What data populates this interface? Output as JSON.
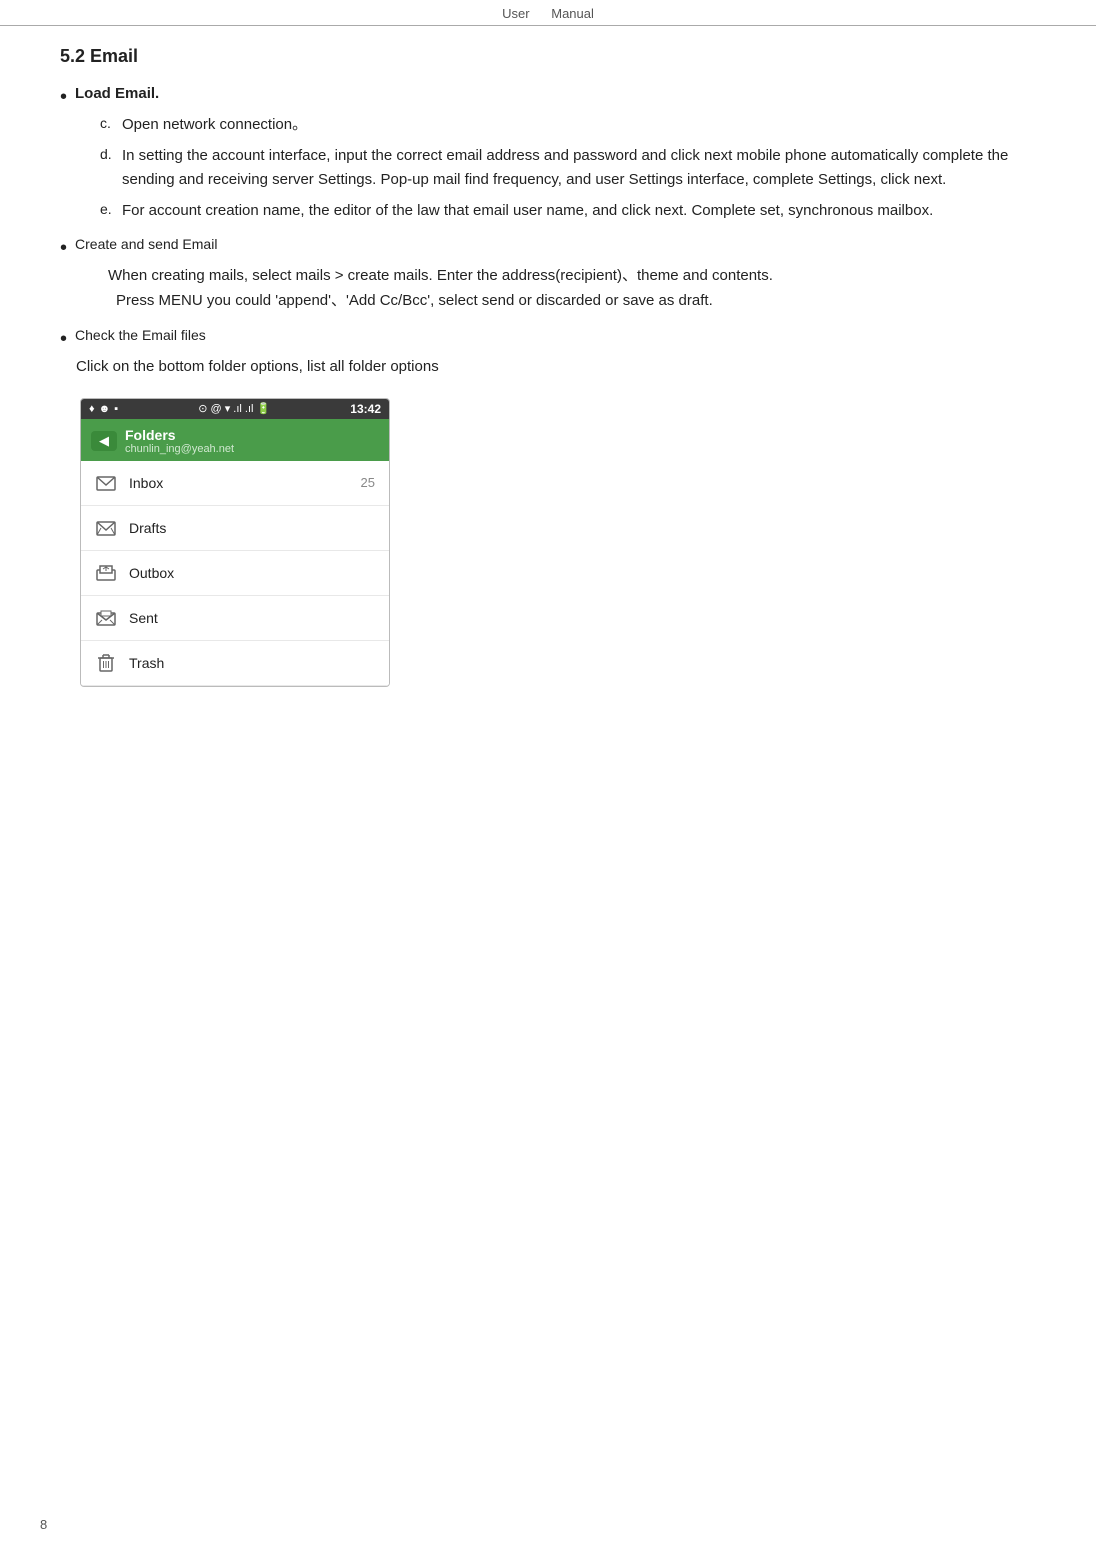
{
  "header": {
    "left": "User",
    "right": "Manual"
  },
  "section": {
    "title": "5.2 Email"
  },
  "bullets": [
    {
      "label": "Load Email.",
      "bold": true,
      "sub_items": [
        {
          "letter": "c.",
          "text": "Open network connection。"
        },
        {
          "letter": "d.",
          "text": "In setting the account interface, input the correct email address and password and click next mobile phone automatically complete the sending and receiving server Settings. Pop-up mail find frequency, and user Settings interface, complete Settings, click next."
        },
        {
          "letter": "e.",
          "text": "For account creation name, the editor of the law that email user name, and click next. Complete set, synchronous mailbox."
        }
      ]
    },
    {
      "label": "Create and send Email",
      "bold": false,
      "body_lines": [
        "When creating mails, select mails > create mails. Enter the address(recipient)、theme and contents.",
        "Press MENU you could 'append'、'Add Cc/Bcc',   select send or discarded or save as draft."
      ]
    },
    {
      "label": "Check the Email files",
      "bold": false,
      "body_lines": [
        "Click on the bottom folder options, list all folder options"
      ]
    }
  ],
  "phone": {
    "status_bar": {
      "left_icons": [
        "♦",
        "☻",
        "▪"
      ],
      "center": "⊙ @ ▾ .ıl .ıl",
      "time": "13:42"
    },
    "header": {
      "back_label": "◀",
      "title": "Folders",
      "subtitle": "chunlin_ing@yeah.net"
    },
    "folders": [
      {
        "name": "Inbox",
        "count": "25",
        "icon": "✉"
      },
      {
        "name": "Drafts",
        "count": "",
        "icon": "✉"
      },
      {
        "name": "Outbox",
        "count": "",
        "icon": "📤"
      },
      {
        "name": "Sent",
        "count": "",
        "icon": "📨"
      },
      {
        "name": "Trash",
        "count": "",
        "icon": "🗑"
      }
    ]
  },
  "page_number": "8"
}
